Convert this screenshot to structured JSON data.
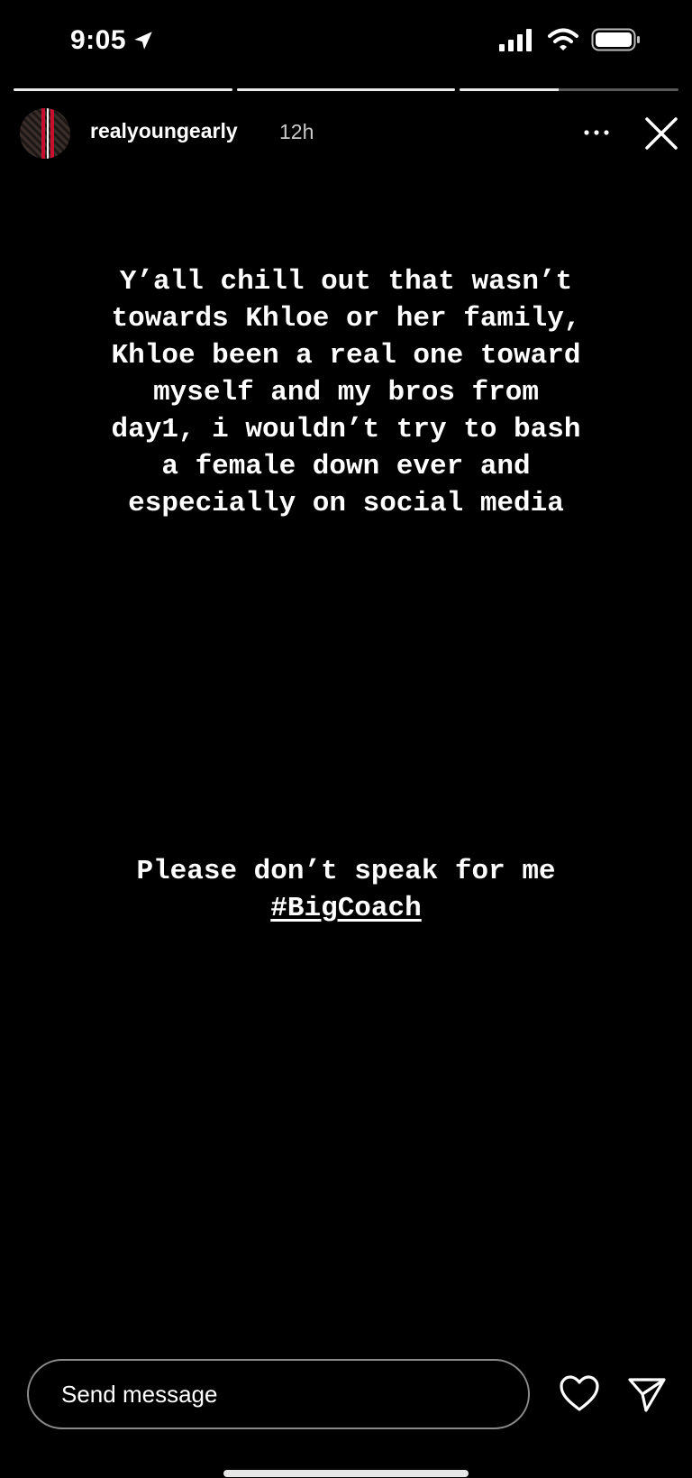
{
  "status_bar": {
    "time": "9:05",
    "icons": [
      "location-arrow-icon",
      "signal-icon",
      "wifi-icon",
      "battery-icon"
    ]
  },
  "progress": [
    1.0,
    1.0,
    0.45
  ],
  "header": {
    "username": "realyoungearly",
    "time_ago": "12h",
    "more_label": "···"
  },
  "story": {
    "main_text": "Y’all chill out that wasn’t\ntowards Khloe or her family,\nKhloe been a real one toward\nmyself and my bros from\nday1, i wouldn’t try to bash\na female down ever and\nespecially on social media",
    "second_text": "Please don’t speak for me",
    "hashtag": "#BigCoach"
  },
  "bottom_bar": {
    "message_placeholder": "Send message"
  },
  "colors": {
    "background": "#000000",
    "text": "#ffffff",
    "secondary_text": "#c9c9c9",
    "input_border": "#8a8a8a"
  }
}
